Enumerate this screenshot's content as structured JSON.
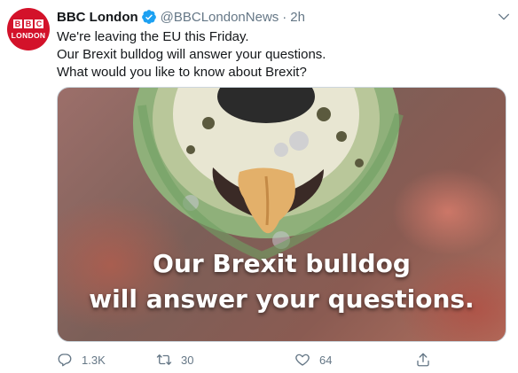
{
  "author": {
    "avatar_letters": [
      "B",
      "B",
      "C"
    ],
    "avatar_city": "LONDON",
    "display_name": "BBC London",
    "handle": "@BBCLondonNews",
    "separator": "·",
    "time": "2h",
    "verified_color": "#1da1f2"
  },
  "tweet": {
    "lines": [
      "We're leaving the EU this Friday.",
      "Our Brexit bulldog will answer your questions.",
      "What would you like to know about Brexit?"
    ]
  },
  "media": {
    "caption_line1": "Our Brexit bulldog",
    "caption_line2": "will answer your questions."
  },
  "actions": {
    "reply_count": "1.3K",
    "retweet_count": "30",
    "like_count": "64"
  },
  "colors": {
    "brand_red": "#d3122a",
    "muted": "#657786",
    "text": "#14171a"
  }
}
